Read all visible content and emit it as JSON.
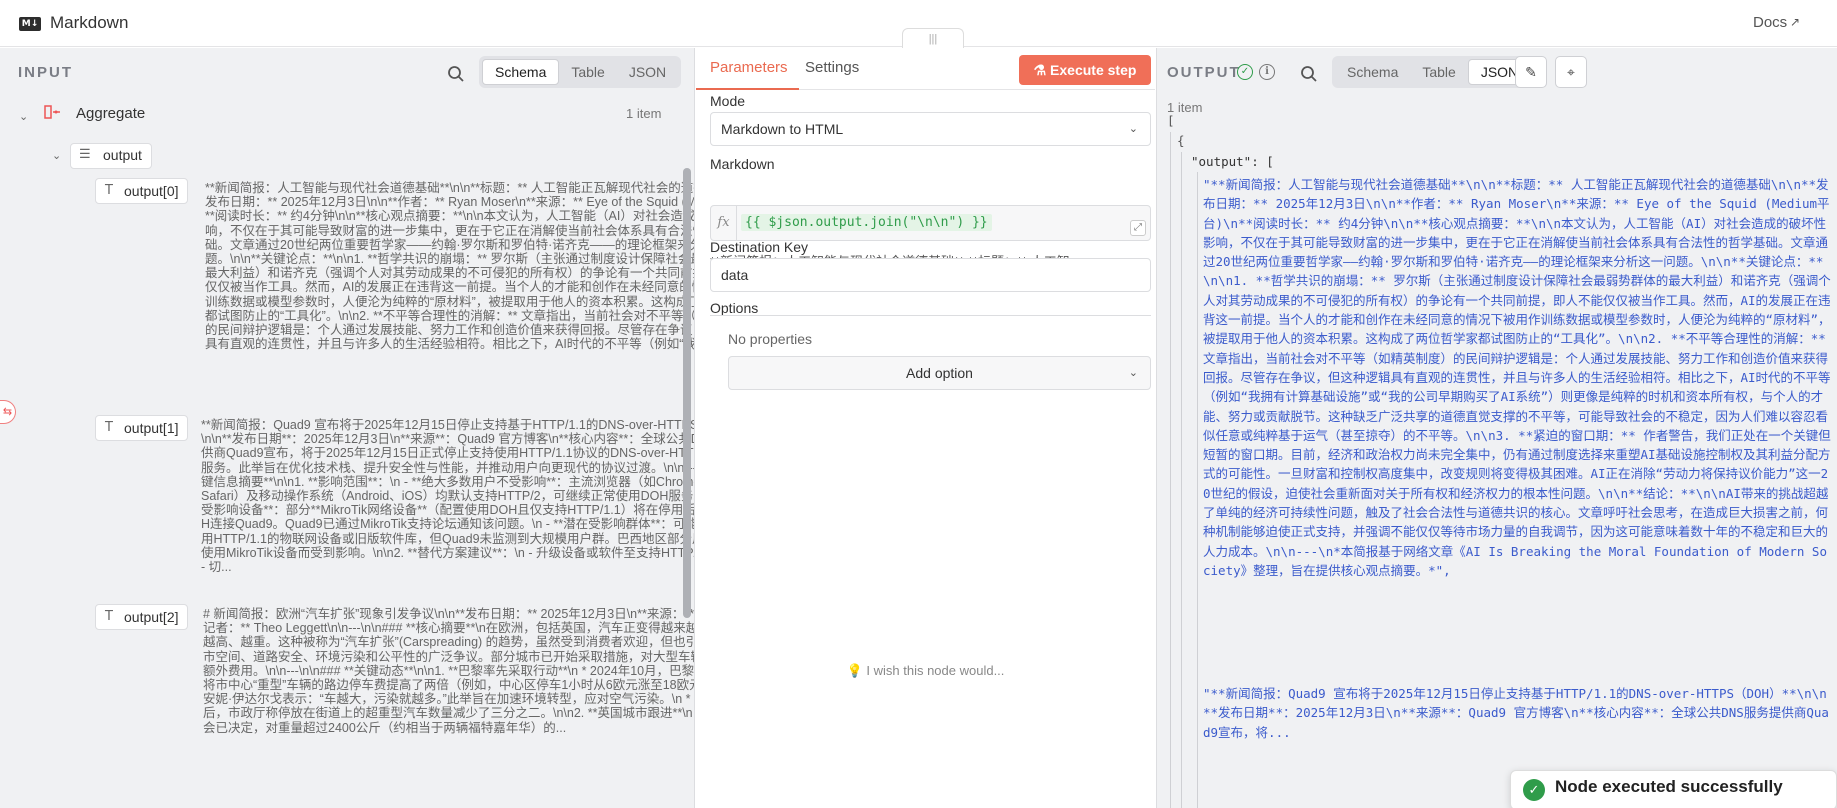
{
  "window": {
    "title": "Markdown",
    "docs_label": "Docs"
  },
  "input": {
    "label": "INPUT",
    "views": [
      "Schema",
      "Table",
      "JSON"
    ],
    "active_view": "Schema",
    "node_name": "Aggregate",
    "item_count": "1 item",
    "field": "output",
    "entries": [
      {
        "label": "output[0]",
        "text": "**新闻简报：人工智能与现代社会道德基础**\\n\\n**标题：** 人工智能正瓦解现代社会的道德基础\\n\\n**发布日期：** 2025年12月3日\\n\\n**作者：** Ryan Moser\\n**来源：** Eye of the Squid (Medium平台)\\n**阅读时长：** 约4分钟\\n\\n**核心观点摘要：**\\n\\n本文认为，人工智能（AI）对社会造成的破坏性影响，不仅在于其可能导致财富的进一步集中，更在于它正在消解使当前社会体系具有合法性的哲学基础。文章通过20世纪两位重要哲学家——约翰·罗尔斯和罗伯特·诺齐克——的理论框架来分析这一问题。\\n\\n**关键论点：**\\n\\n1. **哲学共识的崩塌：** 罗尔斯（主张通过制度设计保障社会最弱势群体的最大利益）和诺齐克（强调个人对其劳动成果的不可侵犯的所有权）的争论有一个共同前提，即人不能仅仅被当作工具。然而，AI的发展正在违背这一前提。当个人的才能和创作在未经同意的情况下被用作训练数据或模型参数时，人便沦为纯粹的“原材料”，被提取用于他人的资本积累。这构成了两位哲学家都试图防止的“工具化”。\\n\\n2. **不平等合理性的消解：** 文章指出，当前社会对不平等（如精英制度）的民间辩护逻辑是：个人通过发展技能、努力工作和创造价值来获得回报。尽管存在争议，但这种逻辑具有直观的连贯性，并且与许多人的生活经验相符。相比之下，AI时代的不平等（例如“我拥有..."
      },
      {
        "label": "output[1]",
        "text": "**新闻简报：Quad9 宣布将于2025年12月15日停止支持基于HTTP/1.1的DNS-over-HTTPS（DOH）**\\n\\n**发布日期**：2025年12月3日\\n**来源**：Quad9 官方博客\\n**核心内容**：全球公共DNS服务提供商Quad9宣布，将于2025年12月15日正式停止支持使用HTTP/1.1协议的DNS-over-HTTPS（DOH）服务。此举旨在优化技术栈、提升安全性与性能，并推动用户向更现代的协议过渡。\\n\\n---\\n\\n### **关键信息摘要**\\n\\n1. **影响范围**：\\n - **绝大多数用户不受影响**：主流浏览器（如Chrome、Firefox、Safari）及移动操作系统（Android、iOS）均默认支持HTTP/2，可继续正常使用DOH服务。\\n - **已知受影响设备**：部分**MikroTik网络设备**（配置使用DOH且仅支持HTTP/1.1）将在停用后无法通过DOH连接Quad9。Quad9已通过MikroTik支持论坛通知该问题。\\n - **潜在受影响群体**：可能存在其他使用HTTP/1.1的物联网设备或旧版软件库，但Quad9未监测到大规模用户群。巴西地区部分用户可能因使用MikroTik设备而受到影响。\\n\\n2. **替代方案建议**：\\n - 升级设备或软件至支持HTTP/2的版本。\\n - 切..."
      },
      {
        "label": "output[2]",
        "text": "# 新闻简报：欧洲“汽车扩张”现象引发争议\\n\\n**发布日期：** 2025年12月3日\\n**来源：** BBC新闻\\n**记者：** Theo Leggett\\n\\n---\\n\\n### **核心摘要**\\n在欧洲，包括英国，汽车正变得越来越长、越宽、越高、越重。这种被称为“汽车扩张”(Carspreading) 的趋势，虽然受到消费者欢迎，但也引发了关于城市空间、道路安全、环境污染和公平性的广泛争议。部分城市已开始采取措施，对大型车辆施加限制或额外费用。\\n\\n---\\n\\n### **关键动态**\\n\\n1. **巴黎率先采取行动**\\n * 2024年10月，巴黎通过公投，将市中心“重型”车辆的路边停车费提高了两倍（例如，中心区停车1小时从6欧元涨至18欧元）。\\n * 市长安妮·伊达尔戈表示：“车越大，污染就越多。”此举旨在加速环境转型，应对空气污染。\\n * 措施实施数月后，市政厅称停放在街道上的超重型汽车数量减少了三分之二。\\n\\n2. **英国城市跟进**\\n * 加的夫市议会已决定，对重量超过2400公斤（约相当于两辆福特嘉年华）的..."
      }
    ]
  },
  "params": {
    "tabs": [
      "Parameters",
      "Settings"
    ],
    "execute_label": "Execute step",
    "mode_label": "Mode",
    "mode_value": "Markdown to HTML",
    "markdown_label": "Markdown",
    "markdown_expr": "{{ $json.output.join(\"\\n\\n\") }}",
    "markdown_preview": "**新闻简报：人工智能与现代社会道德基础**  **标题：**  人工智…",
    "dest_label": "Destination Key",
    "dest_value": "data",
    "options_label": "Options",
    "no_props": "No properties",
    "add_option": "Add option",
    "wish_text": "I wish this node would..."
  },
  "output": {
    "label": "OUTPUT",
    "views": [
      "Schema",
      "Table",
      "JSON"
    ],
    "active_view": "JSON",
    "item_count": "1 item",
    "open_bracket": "[",
    "open_brace": "{",
    "key_line": "\"output\": [",
    "value0": "\"**新闻简报：人工智能与现代社会道德基础**\\n\\n**标题：** 人工智能正瓦解现代社会的道德基础\\n\\n**发布日期：** 2025年12月3日\\n\\n**作者：** Ryan Moser\\n**来源：** Eye of the Squid (Medium平台)\\n**阅读时长：** 约4分钟\\n\\n**核心观点摘要：**\\n\\n本文认为，人工智能（AI）对社会造成的破坏性影响，不仅在于其可能导致财富的进一步集中，更在于它正在消解使当前社会体系具有合法性的哲学基础。文章通过20世纪两位重要哲学家——约翰·罗尔斯和罗伯特·诺齐克——的理论框架来分析这一问题。\\n\\n**关键论点：**\\n\\n1.  **哲学共识的崩塌：** 罗尔斯（主张通过制度设计保障社会最弱势群体的最大利益）和诺齐克（强调个人对其劳动成果的不可侵犯的所有权）的争论有一个共同前提，即人不能仅仅被当作工具。然而，AI的发展正在违背这一前提。当个人的才能和创作在未经同意的情况下被用作训练数据或模型参数时，人便沦为纯粹的“原材料”，被提取用于他人的资本积累。这构成了两位哲学家都试图防止的“工具化”。\\n\\n2.  **不平等合理性的消解：** 文章指出，当前社会对不平等（如精英制度）的民间辩护逻辑是：个人通过发展技能、努力工作和创造价值来获得回报。尽管存在争议，但这种逻辑具有直观的连贯性，并且与许多人的生活经验相符。相比之下，AI时代的不平等（例如“我拥有计算基础设施”或“我的公司早期购买了AI系统”）则更像是纯粹的时机和资本所有权，与个人的才能、努力或贡献脱节。这种缺乏广泛共享的道德直觉支撑的不平等，可能导致社会的不稳定，因为人们难以容忍看似任意或纯粹基于运气（甚至掠夺）的不平等。\\n\\n3.  **紧迫的窗口期：** 作者警告，我们正处在一个关键但短暂的窗口期。目前，经济和政治权力尚未完全集中，仍有通过制度选择来重塑AI基础设施控制权及其利益分配方式的可能性。一旦财富和控制权高度集中，改变规则将变得极其困难。AI正在消除“劳动力将保持议价能力”这一20世纪的假设，迫使社会重新面对关于所有权和经济权力的根本性问题。\\n\\n**结论：**\\n\\nAI带来的挑战超越了单纯的经济可持续性问题，触及了社会合法性与道德共识的核心。文章呼吁社会思考，在造成巨大损害之前，何种机制能够迫使正式支持，并强调不能仅仅等待市场力量的自我调节，因为这可能意味着数十年的不稳定和巨大的人力成本。\\n\\n---\\n*本简报基于网络文章《AI Is Breaking the Moral Foundation of Modern Society》整理，旨在提供核心观点摘要。*\",",
    "value1": "\"**新闻简报：Quad9 宣布将于2025年12月15日停止支持基于HTTP/1.1的DNS-over-HTTPS（DOH）**\\n\\n**发布日期**：2025年12月3日\\n**来源**：Quad9 官方博客\\n**核心内容**：全球公共DNS服务提供商Quad9宣布，将..."
  },
  "toast": {
    "message": "Node executed successfully"
  },
  "colors": {
    "accent": "#ea6a50",
    "success": "#2f9c4a",
    "expr_green": "#2f9c4a"
  }
}
